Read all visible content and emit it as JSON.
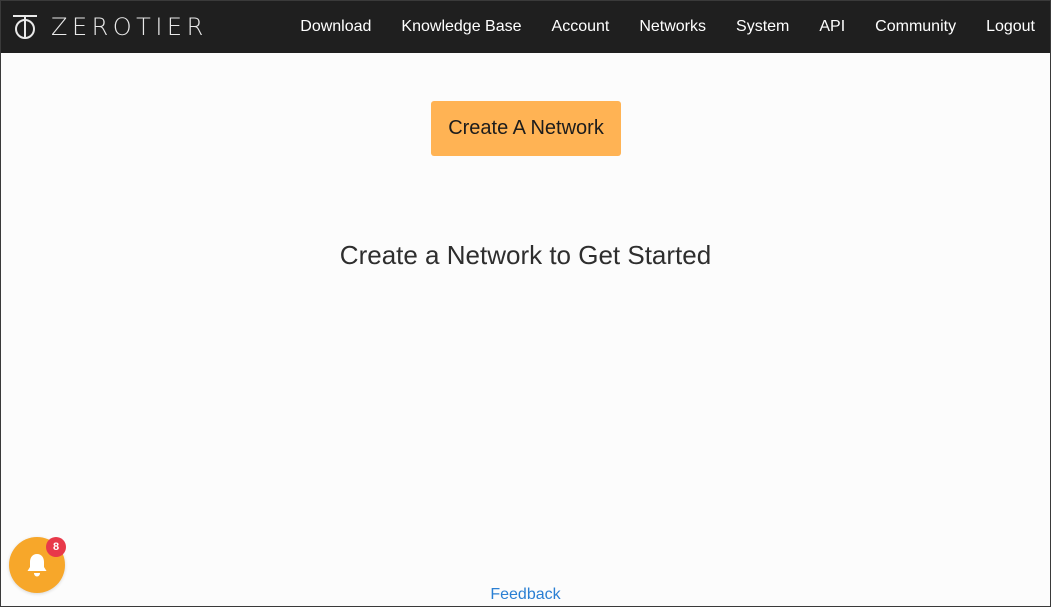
{
  "header": {
    "logo_text": "ZEROTIER",
    "logo_icon": "zerotier-logo-icon",
    "nav": [
      {
        "label": "Download"
      },
      {
        "label": "Knowledge Base"
      },
      {
        "label": "Account"
      },
      {
        "label": "Networks"
      },
      {
        "label": "System"
      },
      {
        "label": "API"
      },
      {
        "label": "Community"
      },
      {
        "label": "Logout"
      }
    ]
  },
  "main": {
    "create_button_label": "Create A Network",
    "empty_state_heading": "Create a Network to Get Started"
  },
  "notifications": {
    "icon": "bell-icon",
    "count": "8"
  },
  "footer": {
    "feedback_label": "Feedback"
  },
  "colors": {
    "topbar": "#1f1f1f",
    "accent": "#ffb354",
    "bell": "#f7a72a",
    "badge": "#e8394a",
    "link": "#2a7fd3"
  }
}
